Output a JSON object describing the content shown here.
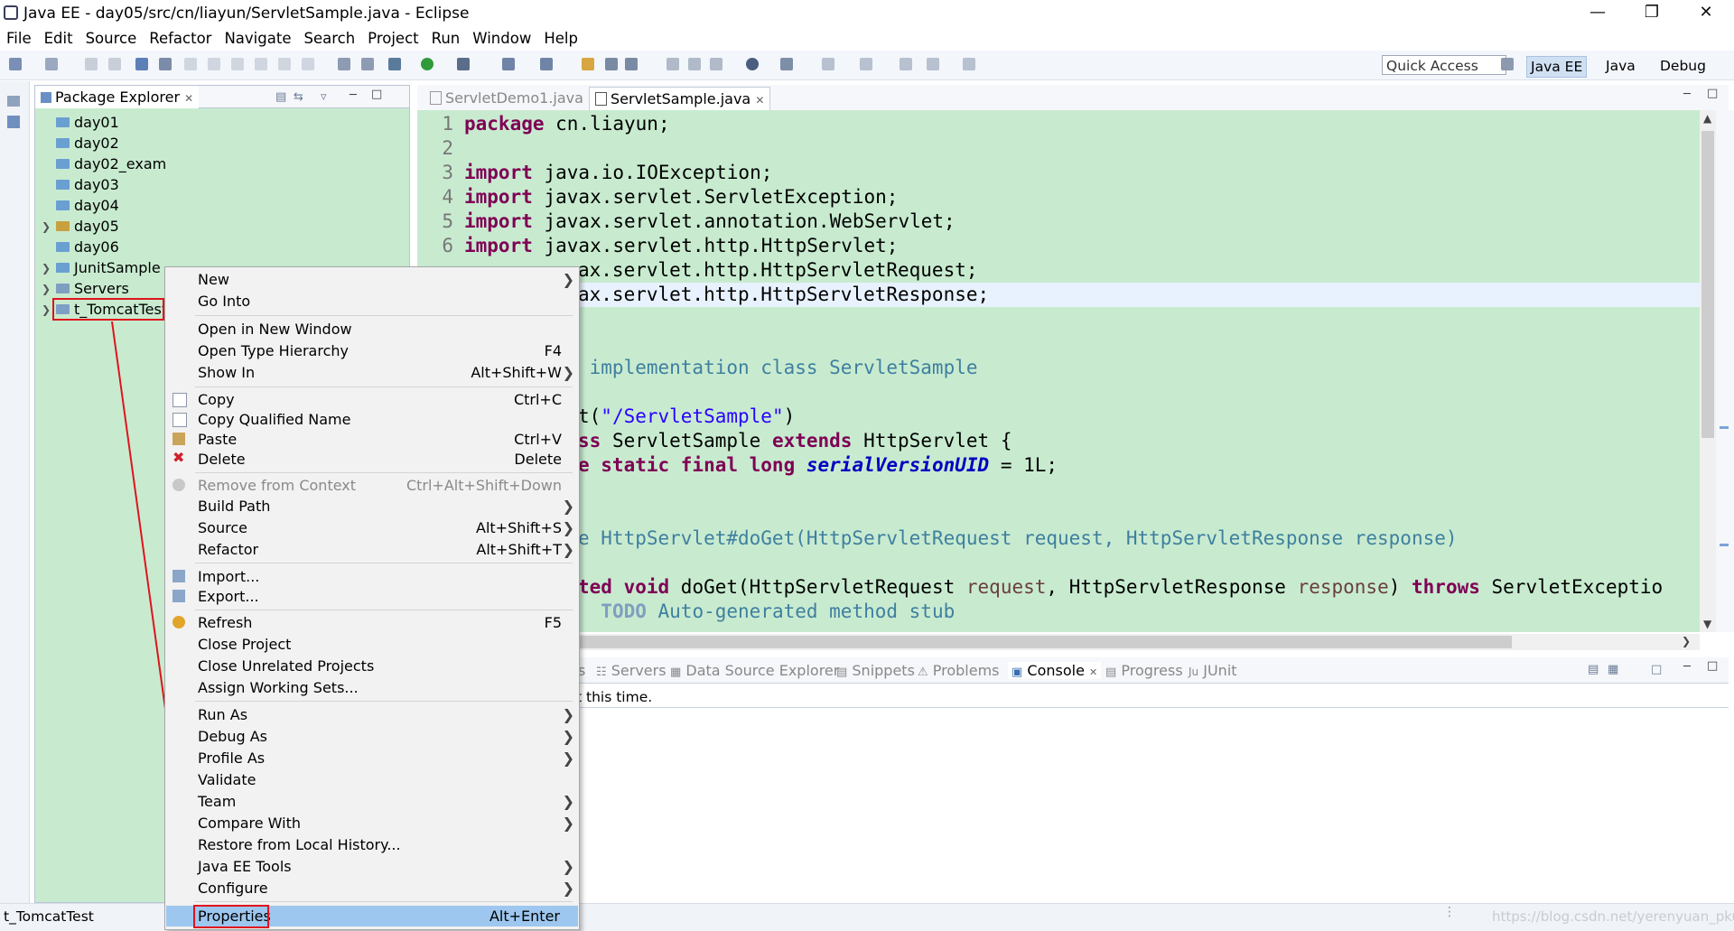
{
  "window": {
    "title": "Java EE - day05/src/cn/liayun/ServletSample.java - Eclipse"
  },
  "menubar": [
    "File",
    "Edit",
    "Source",
    "Refactor",
    "Navigate",
    "Search",
    "Project",
    "Run",
    "Window",
    "Help"
  ],
  "toolbar": {
    "quick_access": "Quick Access",
    "perspectives": [
      "Java EE",
      "Java",
      "Debug"
    ]
  },
  "package_explorer": {
    "tab_label": "Package Explorer",
    "items": [
      "day01",
      "day02",
      "day02_exam",
      "day03",
      "day04",
      "day05",
      "day06",
      "JunitSample",
      "Servers",
      "t_TomcatTest"
    ]
  },
  "editor": {
    "tabs": [
      "ServletDemo1.java",
      "ServletSample.java"
    ],
    "line_numbers": [
      "1",
      "2",
      "3",
      "4",
      "5",
      "6"
    ],
    "lines": [
      {
        "kw": "package",
        "rest": " cn.liayun;"
      },
      {
        "kw": "",
        "rest": ""
      },
      {
        "kw": "import",
        "rest": " java.io.IOException;"
      },
      {
        "kw": "import",
        "rest": " javax.servlet.ServletException;"
      },
      {
        "kw": "import",
        "rest": " javax.servlet.annotation.WebServlet;"
      },
      {
        "kw": "import",
        "rest": " javax.servlet.http.HttpServlet;"
      }
    ],
    "partial_lines": {
      "l7": "ax.servlet.http.HttpServletRequest;",
      "l8": "ax.servlet.http.HttpServletResponse;",
      "l10": " implementation class ServletSample",
      "l12a": "t(",
      "l12b": "\"/ServletSample\"",
      "l12c": ")",
      "l13kw": "ss",
      "l13mid": " ServletSample ",
      "l13kw2": "extends",
      "l13end": " HttpServlet {",
      "l14kw": "e static final long",
      "l14fld": "serialVersionUID",
      "l14end": " = 1L;",
      "l16": "e HttpServlet#doGet(HttpServletRequest request, HttpServletResponse response)",
      "l18kw": "ted void",
      "l18a": " doGet(HttpServletRequest ",
      "l18v1": "request",
      "l18b": ", HttpServletResponse ",
      "l18v2": "response",
      "l18c": ") ",
      "l18kw2": "throws",
      "l18d": " ServletExceptio",
      "l19todo": "TODO",
      "l19rest": " Auto-generated method stub"
    }
  },
  "bottom_panel": {
    "tabs": [
      "s",
      "Servers",
      "Data Source Explorer",
      "Snippets",
      "Problems",
      "Console",
      "Progress",
      "JUnit"
    ],
    "active": "Console",
    "console_text": "t this time."
  },
  "status": {
    "selected": "t_TomcatTest",
    "watermark": "https://blog.csdn.net/yerenyuan_pku"
  },
  "context_menu": {
    "items": [
      {
        "label": "New",
        "shortcut": "",
        "submenu": true
      },
      {
        "label": "Go Into",
        "shortcut": ""
      },
      {
        "label": "Open in New Window",
        "shortcut": ""
      },
      {
        "label": "Open Type Hierarchy",
        "shortcut": "F4"
      },
      {
        "label": "Show In",
        "shortcut": "Alt+Shift+W",
        "submenu": true
      },
      {
        "label": "Copy",
        "shortcut": "Ctrl+C"
      },
      {
        "label": "Copy Qualified Name",
        "shortcut": ""
      },
      {
        "label": "Paste",
        "shortcut": "Ctrl+V"
      },
      {
        "label": "Delete",
        "shortcut": "Delete"
      },
      {
        "label": "Remove from Context",
        "shortcut": "Ctrl+Alt+Shift+Down",
        "disabled": true
      },
      {
        "label": "Build Path",
        "shortcut": "",
        "submenu": true
      },
      {
        "label": "Source",
        "shortcut": "Alt+Shift+S",
        "submenu": true
      },
      {
        "label": "Refactor",
        "shortcut": "Alt+Shift+T",
        "submenu": true
      },
      {
        "label": "Import...",
        "shortcut": ""
      },
      {
        "label": "Export...",
        "shortcut": ""
      },
      {
        "label": "Refresh",
        "shortcut": "F5"
      },
      {
        "label": "Close Project",
        "shortcut": ""
      },
      {
        "label": "Close Unrelated Projects",
        "shortcut": ""
      },
      {
        "label": "Assign Working Sets...",
        "shortcut": ""
      },
      {
        "label": "Run As",
        "shortcut": "",
        "submenu": true
      },
      {
        "label": "Debug As",
        "shortcut": "",
        "submenu": true
      },
      {
        "label": "Profile As",
        "shortcut": "",
        "submenu": true
      },
      {
        "label": "Validate",
        "shortcut": ""
      },
      {
        "label": "Team",
        "shortcut": "",
        "submenu": true
      },
      {
        "label": "Compare With",
        "shortcut": "",
        "submenu": true
      },
      {
        "label": "Restore from Local History...",
        "shortcut": ""
      },
      {
        "label": "Java EE Tools",
        "shortcut": "",
        "submenu": true
      },
      {
        "label": "Configure",
        "shortcut": "",
        "submenu": true
      },
      {
        "label": "Properties",
        "shortcut": "Alt+Enter",
        "highlighted": true
      }
    ]
  },
  "colors": {
    "editor_bg": "#c8ebd0",
    "highlight": "#9dc7ef",
    "annotation_red": "#e0141c"
  }
}
